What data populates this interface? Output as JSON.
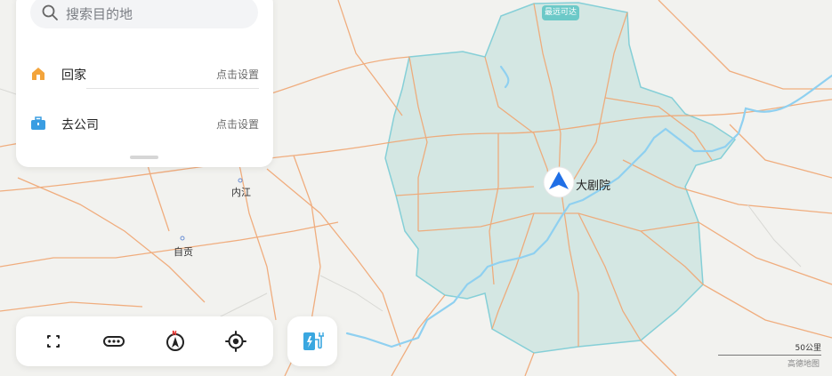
{
  "search": {
    "placeholder": "搜索目的地",
    "icon": "search-icon"
  },
  "shortcuts": [
    {
      "label": "回家",
      "action": "点击设置",
      "icon": "home-icon",
      "color": "#f3a43b"
    },
    {
      "label": "去公司",
      "action": "点击设置",
      "icon": "briefcase-icon",
      "color": "#3a9de2"
    }
  ],
  "toolbar": {
    "icons": [
      "expand-icon",
      "more-icon",
      "compass-icon",
      "locate-icon"
    ]
  },
  "charge": {
    "icon": "ev-charging-icon",
    "color": "#3aa7e0"
  },
  "map": {
    "badge": "最远可达",
    "destination": "大剧院",
    "places": [
      {
        "name": "内江"
      },
      {
        "name": "自贡"
      }
    ],
    "scale": "50公里",
    "brand": "高德地图",
    "colors": {
      "reach_area": "#cfe5e2",
      "roads": "#f0a672",
      "river": "#8fd0f0",
      "marker": "#1f6fe6"
    }
  }
}
